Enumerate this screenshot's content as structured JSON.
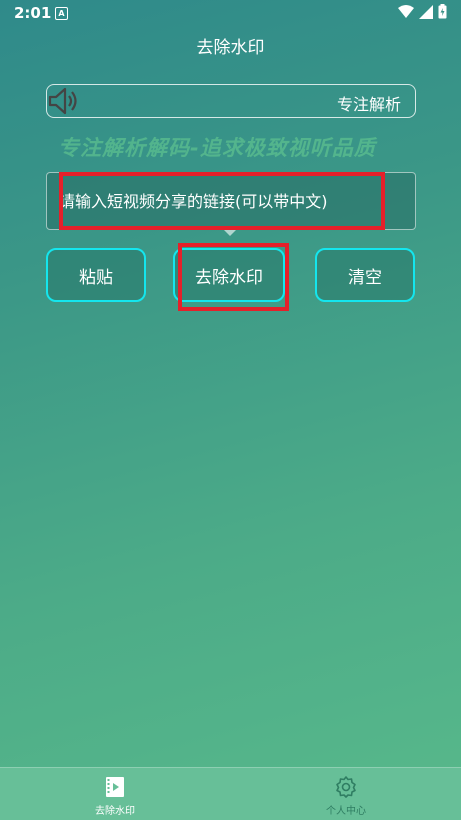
{
  "status_bar": {
    "time": "2:01",
    "app_icon_letter": "A"
  },
  "header": {
    "title": "去除水印"
  },
  "marquee": {
    "text": "专注解析"
  },
  "slogan": "专注解析解码-追求极致视听品质",
  "url_input": {
    "placeholder": "请输入短视频分享的链接(可以带中文)",
    "value": ""
  },
  "buttons": {
    "paste": "粘贴",
    "remove_watermark": "去除水印",
    "clear": "清空"
  },
  "bottom_nav": {
    "items": [
      {
        "label": "去除水印",
        "icon": "film-icon",
        "active": true
      },
      {
        "label": "个人中心",
        "icon": "gear-icon",
        "active": false
      }
    ]
  },
  "colors": {
    "accent_border": "#14e6ee",
    "highlight": "#e5202a",
    "nav_bg": "#67bf98"
  }
}
